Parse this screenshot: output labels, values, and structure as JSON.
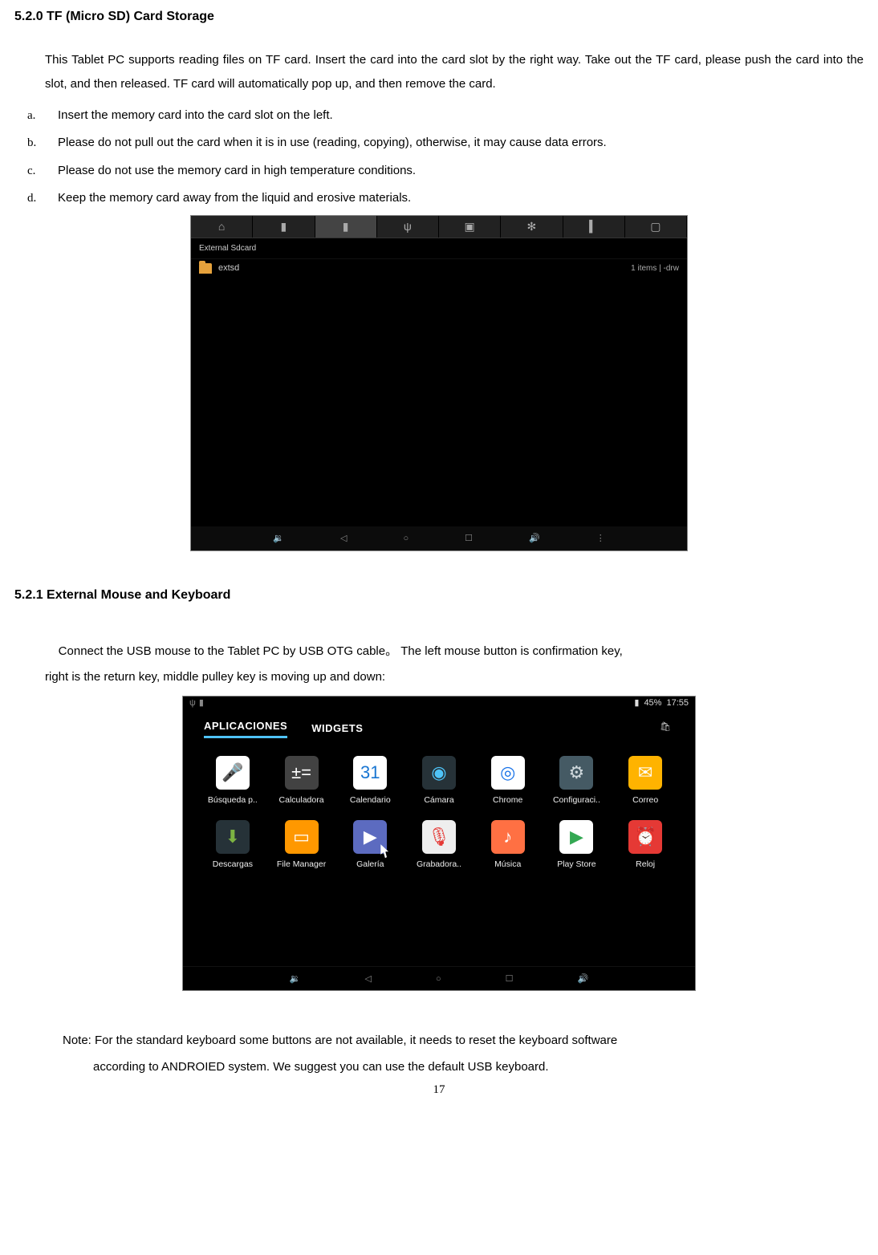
{
  "section1": {
    "heading": "5.2.0 TF (Micro SD) Card Storage",
    "intro": "This Tablet PC supports reading files on TF card. Insert the card into the card slot by the right way. Take out the TF card, please push the card into the slot, and then released. TF card will automatically pop up, and then remove the card.",
    "items": [
      {
        "marker": "a.",
        "text": "Insert the memory card into the card slot on the left."
      },
      {
        "marker": "b.",
        "text": "Please do not pull out the card when it is in use (reading, copying), otherwise, it may cause data errors."
      },
      {
        "marker": "c.",
        "text": "Please do not use the memory card in high temperature conditions."
      },
      {
        "marker": "d.",
        "text": "Keep the memory card away from the liquid and erosive materials."
      }
    ]
  },
  "screenshot1": {
    "breadcrumb": "External Sdcard",
    "folder_name": "extsd",
    "folder_meta": "1 items | -drw",
    "tabs_icons": [
      "home-icon",
      "sd-icon",
      "sd2-icon",
      "usb-icon",
      "image-icon",
      "movie-icon",
      "bar-icon",
      "box-icon"
    ]
  },
  "section2": {
    "heading": "5.2.1 External Mouse and Keyboard",
    "para_a": "Connect the USB mouse to the Tablet PC by USB OTG cable。 The left mouse button is confirmation key,",
    "para_b": "right is the return key, middle pulley key is moving up and down:"
  },
  "screenshot2": {
    "battery": "45%",
    "time": "17:55",
    "tabs": {
      "apps": "APLICACIONES",
      "widgets": "WIDGETS"
    },
    "apps_row1": [
      {
        "name": "voice-search",
        "label": "Búsqueda p..",
        "bg": "#ffffff",
        "glyph": "🎤",
        "fg": "#e53935"
      },
      {
        "name": "calculator",
        "label": "Calculadora",
        "bg": "#424242",
        "glyph": "±=",
        "fg": "#fff"
      },
      {
        "name": "calendar",
        "label": "Calendario",
        "bg": "#ffffff",
        "glyph": "31",
        "fg": "#1976d2"
      },
      {
        "name": "camera",
        "label": "Cámara",
        "bg": "#263238",
        "glyph": "◉",
        "fg": "#4fc3f7"
      },
      {
        "name": "chrome",
        "label": "Chrome",
        "bg": "#fff",
        "glyph": "◎",
        "fg": "#1a73e8"
      },
      {
        "name": "settings",
        "label": "Configuraci..",
        "bg": "#455a64",
        "glyph": "⚙",
        "fg": "#cfd8dc"
      },
      {
        "name": "email",
        "label": "Correo",
        "bg": "#ffb300",
        "glyph": "✉",
        "fg": "#fff"
      }
    ],
    "apps_row2": [
      {
        "name": "downloads",
        "label": "Descargas",
        "bg": "#263238",
        "glyph": "⬇",
        "fg": "#7cb342"
      },
      {
        "name": "file-manager",
        "label": "File Manager",
        "bg": "#ff9800",
        "glyph": "▭",
        "fg": "#fff"
      },
      {
        "name": "gallery",
        "label": "Galería",
        "bg": "#5c6bc0",
        "glyph": "▶",
        "fg": "#fff",
        "cursor": true
      },
      {
        "name": "recorder",
        "label": "Grabadora..",
        "bg": "#eeeeee",
        "glyph": "🎙",
        "fg": "#e53935"
      },
      {
        "name": "music",
        "label": "Música",
        "bg": "#ff7043",
        "glyph": "♪",
        "fg": "#fff"
      },
      {
        "name": "play-store",
        "label": "Play Store",
        "bg": "#ffffff",
        "glyph": "▶",
        "fg": "#34a853"
      },
      {
        "name": "clock",
        "label": "Reloj",
        "bg": "#e53935",
        "glyph": "⏰",
        "fg": "#fff"
      }
    ]
  },
  "note": {
    "line1": "Note: For the standard keyboard some buttons are not available, it needs to reset the keyboard software",
    "line2": "according to ANDROIED system. We suggest you can use the default USB keyboard."
  },
  "page_number": "17"
}
